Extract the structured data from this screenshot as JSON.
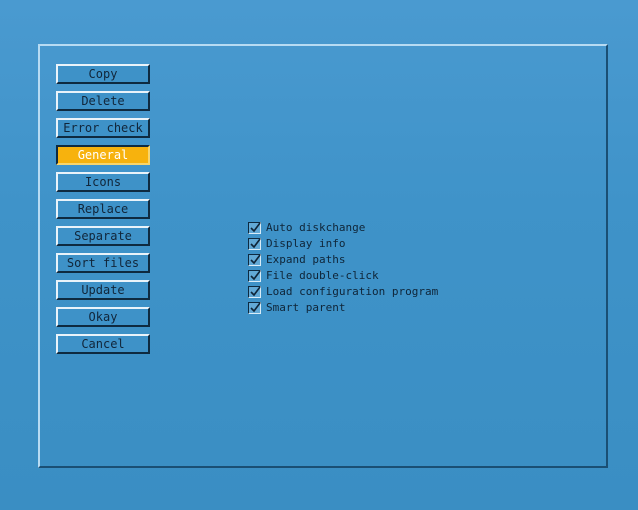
{
  "buttons": [
    {
      "label": "Copy",
      "active": false
    },
    {
      "label": "Delete",
      "active": false
    },
    {
      "label": "Error check",
      "active": false
    },
    {
      "label": "General",
      "active": true
    },
    {
      "label": "Icons",
      "active": false
    },
    {
      "label": "Replace",
      "active": false
    },
    {
      "label": "Separate",
      "active": false
    },
    {
      "label": "Sort files",
      "active": false
    },
    {
      "label": "Update",
      "active": false
    },
    {
      "label": "Okay",
      "active": false
    },
    {
      "label": "Cancel",
      "active": false
    }
  ],
  "options": [
    {
      "label": "Auto diskchange",
      "checked": true
    },
    {
      "label": "Display info",
      "checked": true
    },
    {
      "label": "Expand paths",
      "checked": true
    },
    {
      "label": "File double-click",
      "checked": true
    },
    {
      "label": "Load configuration program",
      "checked": true
    },
    {
      "label": "Smart parent",
      "checked": true
    }
  ],
  "colors": {
    "background": "#3f93c9",
    "active_button": "#f7b20d",
    "text": "#11263a"
  }
}
